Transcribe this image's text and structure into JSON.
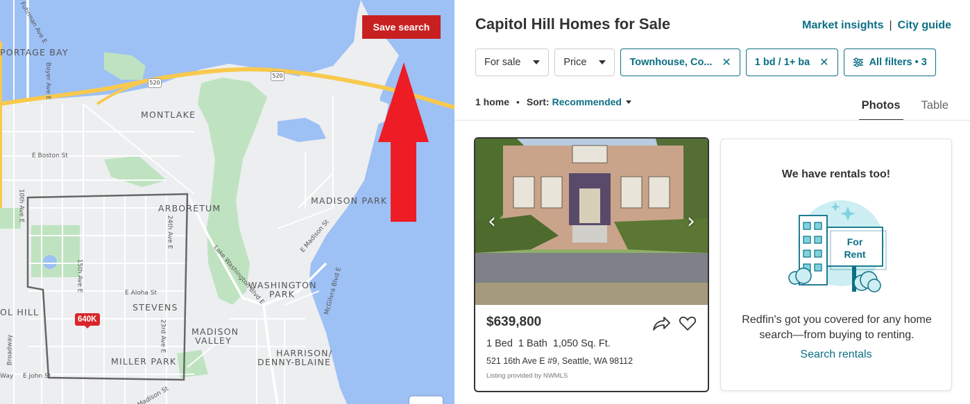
{
  "map": {
    "save_search_label": "Save search",
    "neighborhood_labels": {
      "portage_bay": "PORTAGE BAY",
      "montlake": "MONTLAKE",
      "arboretum": "ARBORETUM",
      "madison_park": "MADISON PARK",
      "washington_park_1": "WASHINGTON",
      "washington_park_2": "PARK",
      "stevens": "STEVENS",
      "madison_valley_1": "MADISON",
      "madison_valley_2": "VALLEY",
      "harrison_1": "HARRISON/",
      "harrison_2": "DENNY-BLAINE",
      "miller_park": "MILLER PARK",
      "capitol_hill": "OL HILL"
    },
    "street_labels": {
      "fuhrman": "Fuhrman Ave E",
      "boyer": "Boyer Ave E",
      "boston": "E Boston St",
      "tenth": "10th Ave E",
      "fifteenth": "15th Ave E",
      "twenty_fourth": "24th Ave E",
      "twenty_third": "23rd Ave E",
      "aloha": "E Aloha St",
      "madison_st": "E Madison St",
      "lake_washington": "Lake Washington Blvd E",
      "mcgilvra": "McGilvra Blvd E",
      "broadway": "Broadway",
      "john": "E John St",
      "way": "Way",
      "madison_bottom": "Madison St"
    },
    "highway_shield": "520",
    "price_pin": "640K",
    "colors": {
      "water": "#9dc0f5",
      "land": "#eceef0",
      "park": "#bfe3c0",
      "highway": "#f9c94e",
      "boundary": "#666666",
      "arrow": "#ee1c24"
    }
  },
  "header": {
    "title": "Capitol Hill Homes for Sale",
    "market_insights": "Market insights",
    "link_separator": "|",
    "city_guide": "City guide"
  },
  "filters": {
    "for_sale": "For sale",
    "price": "Price",
    "home_type": "Townhouse, Co...",
    "beds_baths": "1 bd / 1+ ba",
    "all_filters": "All filters • 3"
  },
  "results": {
    "count": "1 home",
    "separator": "•",
    "sort_label": "Sort:",
    "sort_value": "Recommended"
  },
  "view_tabs": {
    "photos": "Photos",
    "table": "Table"
  },
  "listing": {
    "price": "$639,800",
    "beds": "1 Bed",
    "baths": "1 Bath",
    "sqft": "1,050 Sq. Ft.",
    "address": "521 16th Ave E #9, Seattle, WA 98112",
    "provider": "Listing provided by NWMLS"
  },
  "rentals": {
    "title": "We have rentals too!",
    "sign_line1": "For",
    "sign_line2": "Rent",
    "description": "Redfin's got you covered for any home search—from buying to renting.",
    "link": "Search rentals"
  }
}
